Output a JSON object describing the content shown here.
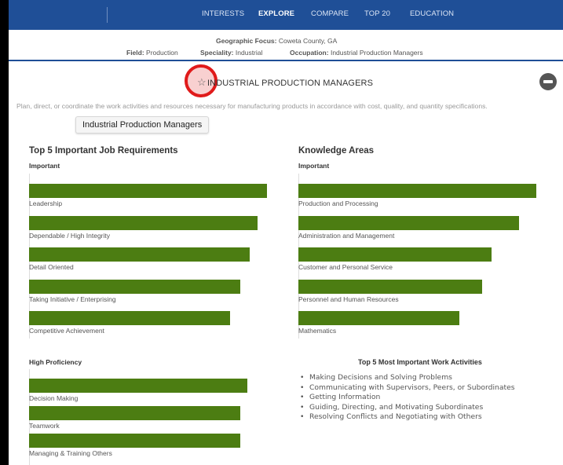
{
  "nav": {
    "items": [
      {
        "label": "INTERESTS",
        "active": false
      },
      {
        "label": "EXPLORE",
        "active": true
      },
      {
        "label": "COMPARE",
        "active": false
      },
      {
        "label": "TOP 20",
        "active": false
      },
      {
        "label": "EDUCATION",
        "active": false
      }
    ],
    "background": "#1f4f97"
  },
  "context": {
    "geo_label": "Geographic Focus:",
    "geo_value": "Coweta County, GA",
    "field_label": "Field:",
    "field_value": "Production",
    "specialty_label": "Speciality:",
    "specialty_value": "Industrial",
    "occupation_label": "Occupation:",
    "occupation_value": "Industrial Production Managers"
  },
  "occupation": {
    "star_icon": "star-outline-icon",
    "title": "INDUSTRIAL PRODUCTION MANAGERS",
    "collapse_icon": "minus-circle-icon",
    "description": "Plan, direct, or coordinate the work activities and resources necessary for manufacturing products in accordance with cost, quality, and quantity specifications.",
    "tooltip": "Industrial Production Managers"
  },
  "job_requirements": {
    "title": "Top 5 Important Job Requirements",
    "subtitle": "Important",
    "bar_color": "#4c7d12",
    "items": [
      {
        "label": "Leadership",
        "level": 0.96
      },
      {
        "label": "Dependable / High Integrity",
        "level": 0.92
      },
      {
        "label": "Detail Oriented",
        "level": 0.89
      },
      {
        "label": "Taking Initiative / Enterprising",
        "level": 0.85
      },
      {
        "label": "Competitive Achievement",
        "level": 0.81
      }
    ]
  },
  "knowledge_areas": {
    "title": "Knowledge Areas",
    "subtitle": "Important",
    "items": [
      {
        "label": "Production and Processing",
        "level": 0.96
      },
      {
        "label": "Administration and Management",
        "level": 0.89
      },
      {
        "label": "Customer and Personal Service",
        "level": 0.78
      },
      {
        "label": "Personnel and Human Resources",
        "level": 0.74
      },
      {
        "label": "Mathematics",
        "level": 0.65
      }
    ]
  },
  "high_proficiency": {
    "subtitle": "High Proficiency",
    "items": [
      {
        "label": "Decision Making",
        "level": 0.88
      },
      {
        "label": "Teamwork",
        "level": 0.85
      },
      {
        "label": "Managing & Training Others",
        "level": 0.85
      }
    ]
  },
  "work_activities": {
    "title": "Top 5 Most Important Work Activities",
    "items": [
      "Making Decisions and Solving Problems",
      "Communicating with Supervisors, Peers, or Subordinates",
      "Getting Information",
      "Guiding, Directing, and Motivating Subordinates",
      "Resolving Conflicts and Negotiating with Others"
    ]
  }
}
